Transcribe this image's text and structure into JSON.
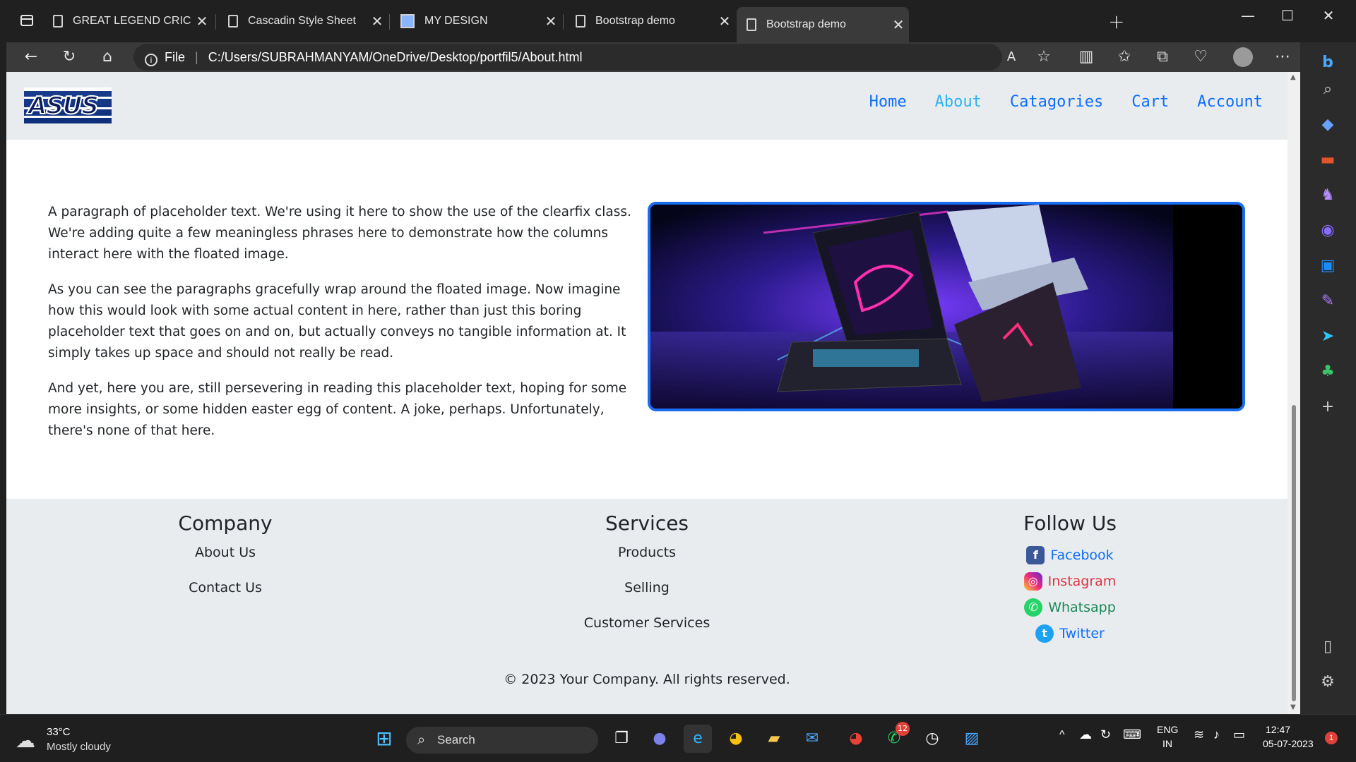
{
  "browser": {
    "tabs": [
      {
        "title": "GREAT LEGEND CRICKETRS",
        "icon": "document-icon"
      },
      {
        "title": "Cascadin Style Sheet",
        "icon": "document-icon"
      },
      {
        "title": "MY DESIGN",
        "icon": "image-icon"
      },
      {
        "title": "Bootstrap demo",
        "icon": "document-icon"
      },
      {
        "title": "Bootstrap demo",
        "icon": "document-icon",
        "active": true
      }
    ],
    "address": {
      "scheme_label": "File",
      "url": "C:/Users/SUBRAHMANYAM/OneDrive/Desktop/portfil5/About.html"
    }
  },
  "page": {
    "logo_text": "ASUS",
    "nav": [
      {
        "label": "Home"
      },
      {
        "label": "About",
        "active": true
      },
      {
        "label": "Catagories"
      },
      {
        "label": "Cart"
      },
      {
        "label": "Account"
      }
    ],
    "paragraphs": [
      "A paragraph of placeholder text. We're using it here to show the use of the clearfix class. We're adding quite a few meaningless phrases here to demonstrate how the columns interact here with the floated image.",
      "As you can see the paragraphs gracefully wrap around the floated image. Now imagine how this would look with some actual content in here, rather than just this boring placeholder text that goes on and on, but actually conveys no tangible information at. It simply takes up space and should not really be read.",
      "And yet, here you are, still persevering in reading this placeholder text, hoping for some more insights, or some hidden easter egg of content. A joke, perhaps. Unfortunately, there's none of that here."
    ],
    "footer": {
      "company": {
        "heading": "Company",
        "links": [
          "About Us",
          "Contact Us"
        ]
      },
      "services": {
        "heading": "Services",
        "links": [
          "Products",
          "Selling",
          "Customer Services"
        ]
      },
      "follow": {
        "heading": "Follow Us",
        "links": [
          {
            "label": "Facebook",
            "color": "#0d6efd"
          },
          {
            "label": "Instagram",
            "color": "#dc3545"
          },
          {
            "label": "Whatsapp",
            "color": "#198754"
          },
          {
            "label": "Twitter",
            "color": "#0d6efd"
          }
        ]
      },
      "copyright": "© 2023 Your Company. All rights reserved."
    }
  },
  "taskbar": {
    "weather": {
      "temp": "33°C",
      "condition": "Mostly cloudy"
    },
    "search_label": "Search",
    "whatsapp_badge": "12",
    "lang": {
      "line1": "ENG",
      "line2": "IN"
    },
    "clock": {
      "time": "12:47",
      "date": "05-07-2023"
    },
    "notification_count": "1"
  }
}
